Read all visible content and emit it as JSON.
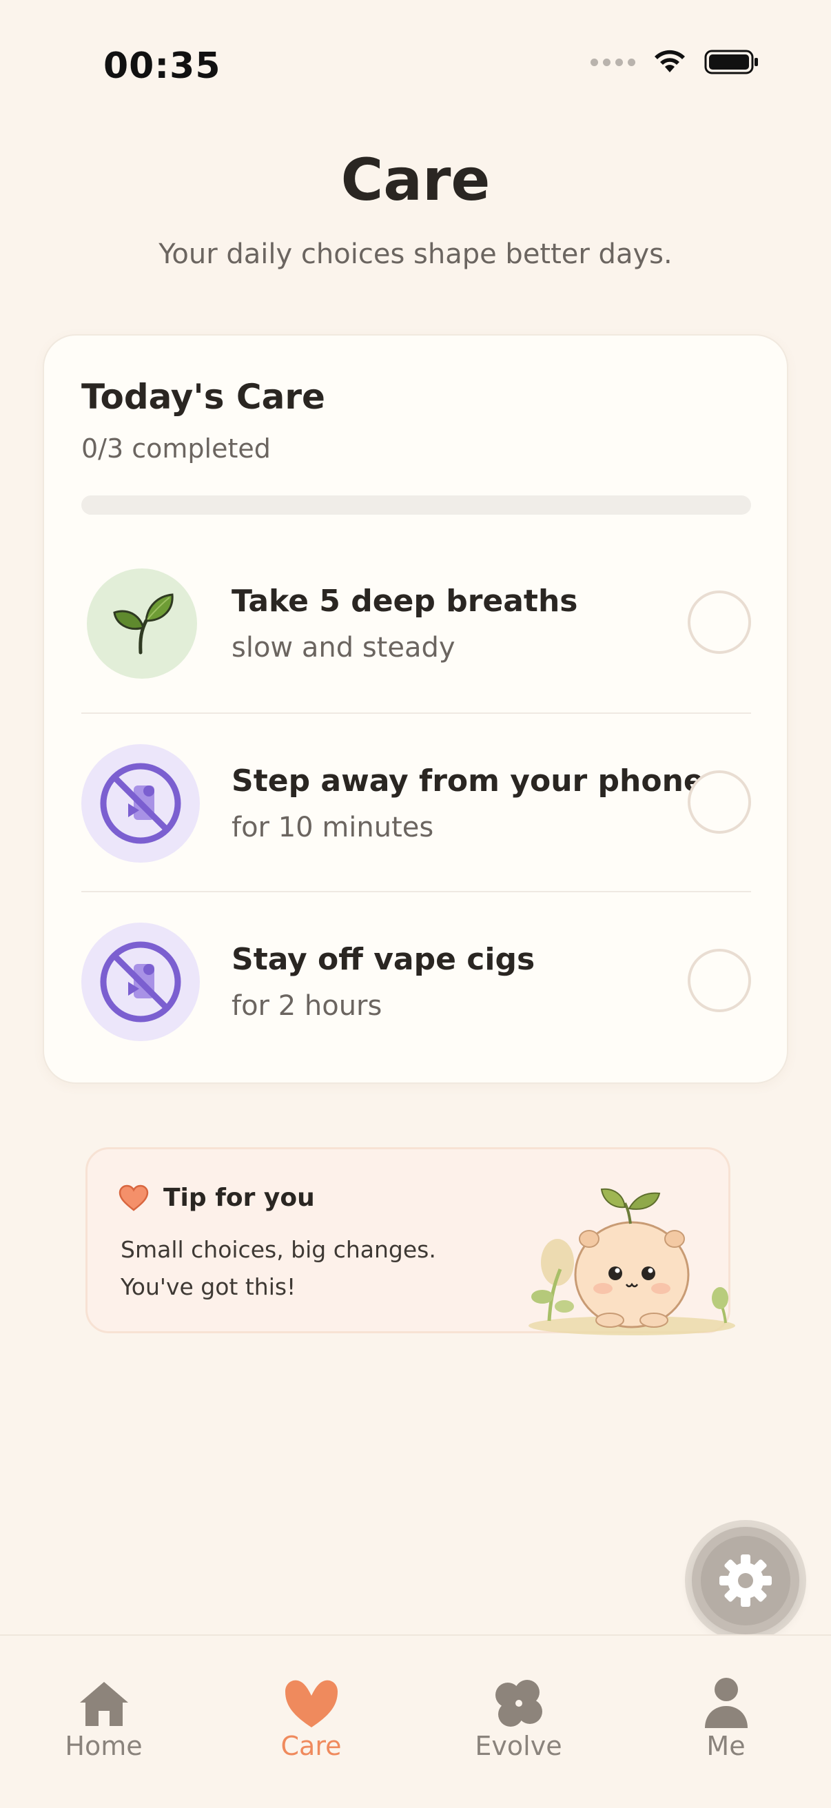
{
  "status_bar": {
    "time": "00:35"
  },
  "header": {
    "title": "Care",
    "subtitle": "Your daily choices shape better days."
  },
  "today_card": {
    "title": "Today's Care",
    "progress_text": "0/3 completed",
    "progress_fraction": 0,
    "tasks": [
      {
        "title": "Take 5 deep breaths",
        "subtitle": "slow and steady",
        "icon": "leaf-icon",
        "completed": false
      },
      {
        "title": "Step away from your phone",
        "subtitle": "for 10 minutes",
        "icon": "no-phone-icon",
        "completed": false
      },
      {
        "title": "Stay off vape cigs",
        "subtitle": "for 2 hours",
        "icon": "no-vape-icon",
        "completed": false
      }
    ]
  },
  "tip": {
    "title": "Tip for you",
    "line1": "Small choices, big changes.",
    "line2": "You've got this!",
    "icon": "heart-icon"
  },
  "fab": {
    "icon": "gear-icon"
  },
  "tab_bar": {
    "tabs": [
      {
        "label": "Home",
        "icon": "home-icon",
        "active": false
      },
      {
        "label": "Care",
        "icon": "heart-icon",
        "active": true
      },
      {
        "label": "Evolve",
        "icon": "clover-icon",
        "active": false
      },
      {
        "label": "Me",
        "icon": "person-icon",
        "active": false
      }
    ]
  },
  "colors": {
    "background": "#fbf4ec",
    "accent": "#ef8a5d",
    "card": "#fffdf8",
    "leaf_circle": "#e2eed8",
    "purple_circle": "#ece6fa",
    "purple": "#7b5fd0",
    "inactive": "#8a837c"
  }
}
